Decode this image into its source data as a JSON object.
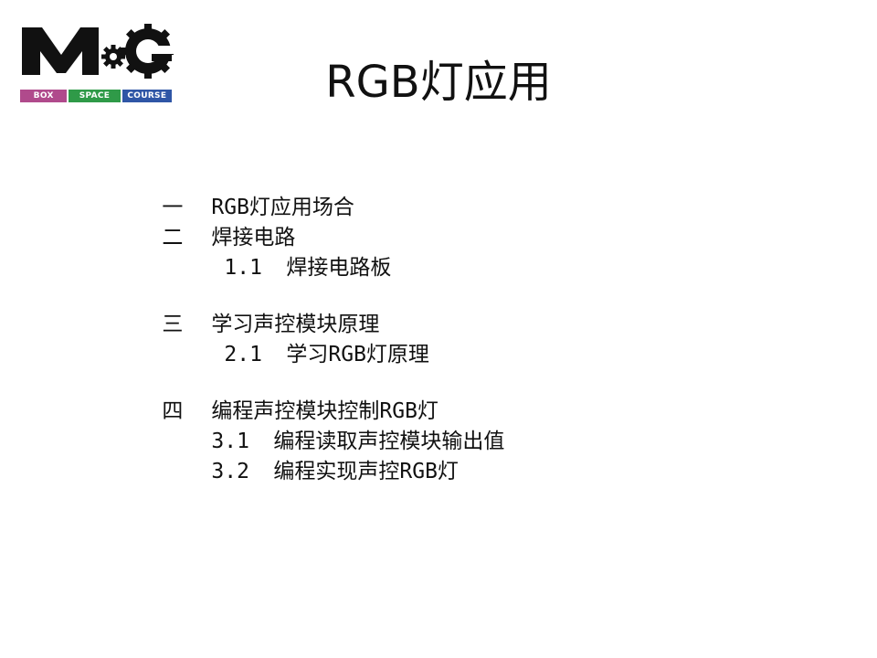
{
  "logo": {
    "mark_text": "MG",
    "segments": [
      {
        "label": "BOX",
        "color": "#b04a8c"
      },
      {
        "label": "SPACE",
        "color": "#2f9a48"
      },
      {
        "label": "COURSE",
        "color": "#2f56a6"
      }
    ]
  },
  "title": "RGB灯应用",
  "outline": {
    "items": [
      {
        "num": "一",
        "text": "RGB灯应用场合"
      },
      {
        "num": "二",
        "text": "焊接电路"
      },
      {
        "num": "1.1",
        "text": "焊接电路板"
      },
      {
        "num": "三",
        "text": "学习声控模块原理"
      },
      {
        "num": "2.1",
        "text": "学习RGB灯原理"
      },
      {
        "num": "四",
        "text": "编程声控模块控制RGB灯"
      },
      {
        "num": "3.1",
        "text": "编程读取声控模块输出值"
      },
      {
        "num": "3.2",
        "text": "编程实现声控RGB灯"
      }
    ]
  }
}
